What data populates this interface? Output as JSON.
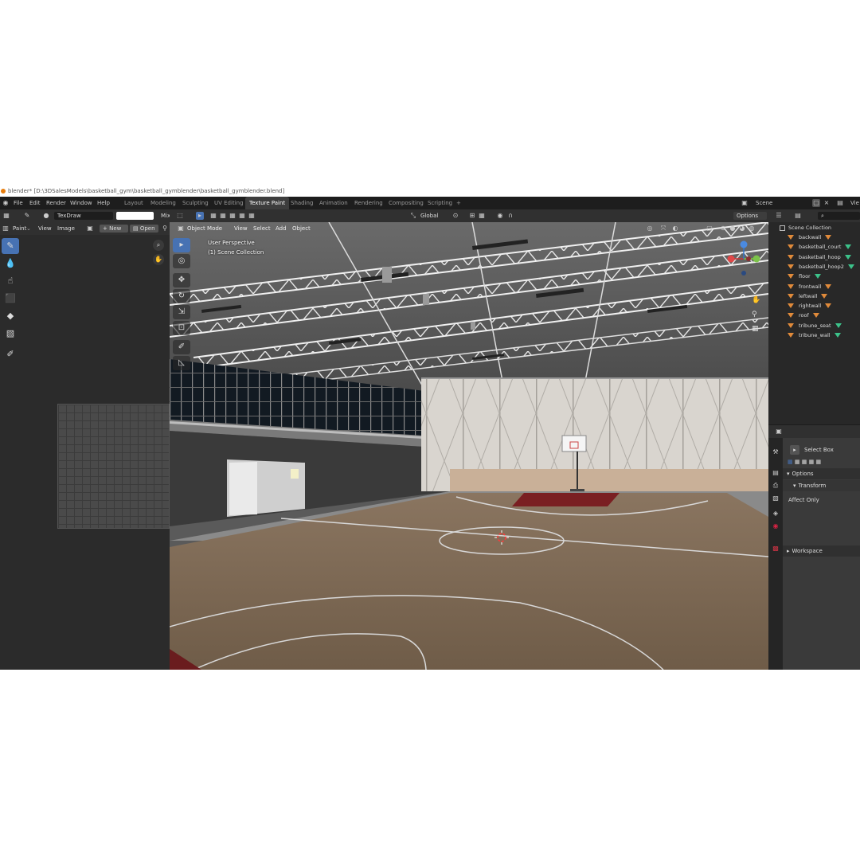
{
  "titlebar": {
    "text": "blender* [D:\\3DSalesModels\\basketball_gym\\basketball_gymblender\\basketball_gymblender.blend]"
  },
  "topbar": {
    "menus": [
      "File",
      "Edit",
      "Render",
      "Window",
      "Help"
    ],
    "workspaces": [
      "Layout",
      "Modeling",
      "Sculpting",
      "UV Editing",
      "Texture Paint",
      "Shading",
      "Animation",
      "Rendering",
      "Compositing",
      "Scripting"
    ],
    "active_workspace": "Texture Paint",
    "scene_label": "Scene",
    "view_layer_label": "Vie"
  },
  "image_editor": {
    "brush_name": "TexDraw",
    "blend_label": "Mix",
    "mode_label": "Paint",
    "menus": [
      "View",
      "Image"
    ],
    "new_label": "New",
    "open_label": "Open"
  },
  "viewport": {
    "mode_label": "Object Mode",
    "menus": [
      "View",
      "Select",
      "Add",
      "Object"
    ],
    "transform_label": "Global",
    "options_label": "Options",
    "perspective_text": "User Perspective",
    "collection_text": "(1) Scene Collection"
  },
  "outliner": {
    "root": "Scene Collection",
    "items": [
      {
        "name": "backwall",
        "mesh": "orange"
      },
      {
        "name": "basketball_court",
        "mesh": "green"
      },
      {
        "name": "basketball_hoop",
        "mesh": "green"
      },
      {
        "name": "basketball_hoop2",
        "mesh": "green"
      },
      {
        "name": "floor",
        "mesh": "green"
      },
      {
        "name": "frontwall",
        "mesh": "orange"
      },
      {
        "name": "leftwall",
        "mesh": "orange"
      },
      {
        "name": "rightwall",
        "mesh": "orange"
      },
      {
        "name": "roof",
        "mesh": "orange"
      },
      {
        "name": "tribune_seat",
        "mesh": "green"
      },
      {
        "name": "tribune_wall",
        "mesh": "green"
      }
    ]
  },
  "properties": {
    "tool_name": "Select Box",
    "options_label": "Options",
    "transform_label": "Transform",
    "affect_only_label": "Affect Only",
    "workspace_label": "Workspace"
  },
  "colors": {
    "accent": "#4772b3",
    "court_wood": "#7d6a55",
    "court_red": "#7a1f22",
    "mesh_orange": "#e08a3a",
    "mesh_green": "#3cc28a"
  }
}
